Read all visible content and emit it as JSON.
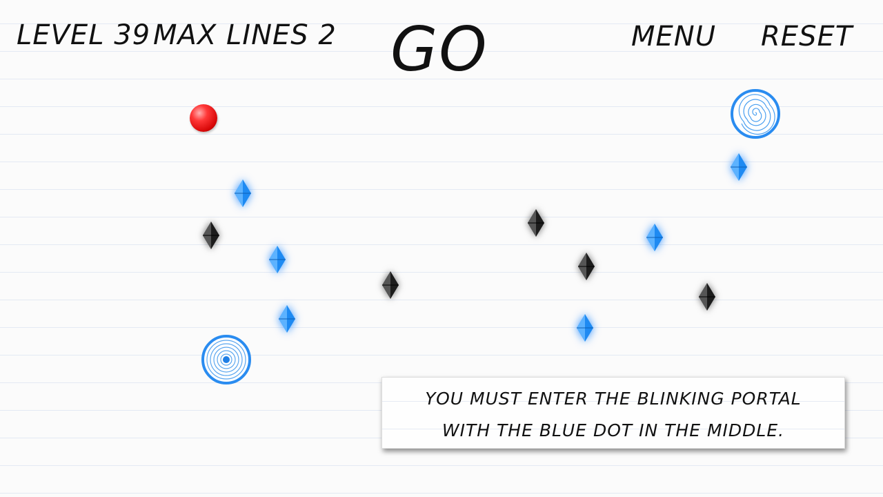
{
  "hud": {
    "level": "Level 39",
    "max_lines": "Max Lines 2",
    "go": "Go",
    "menu": "Menu",
    "reset": "Reset"
  },
  "hint": {
    "line1": "You must enter the blinking portal",
    "line2": "with the blue dot in the middle."
  },
  "colors": {
    "ball": "#e01010",
    "portal": "#2a8cf0",
    "gem_blue": "#2a8cf0",
    "gem_dark": "#2a2a2a",
    "paper_line": "#e3e9f3"
  },
  "icons": {
    "ball": "red-ball",
    "portal_target": "blinking-portal-with-blue-dot",
    "portal_exit": "spiral-portal",
    "gem_blue": "blue-crystal",
    "gem_dark": "black-crystal"
  }
}
